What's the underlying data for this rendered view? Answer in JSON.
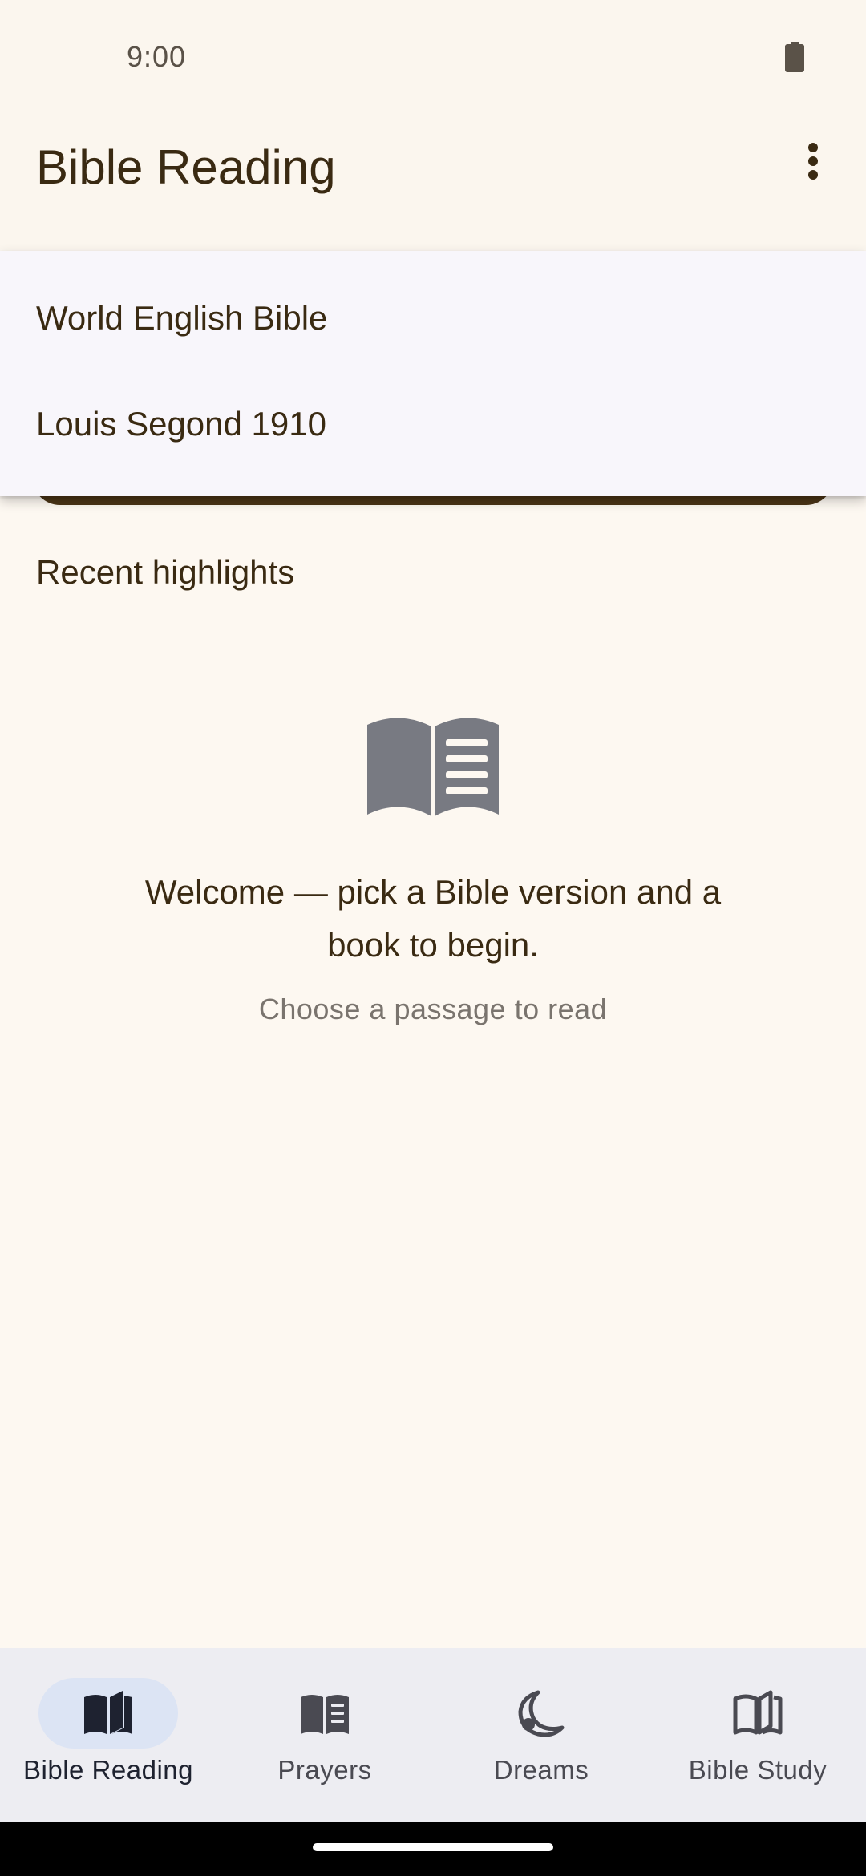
{
  "status_bar": {
    "time": "9:00"
  },
  "app_bar": {
    "title": "Bible Reading",
    "more_icon": "more-vertical-icon"
  },
  "version_menu": {
    "items": [
      {
        "label": "World English Bible"
      },
      {
        "label": "Louis Segond 1910"
      }
    ]
  },
  "main": {
    "recent_heading": "Recent highlights",
    "empty_state": {
      "icon": "book-open-icon",
      "message": "Welcome — pick a Bible version and a book to begin.",
      "subtitle": "Choose a passage to read"
    }
  },
  "bottom_nav": {
    "items": [
      {
        "label": "Bible Reading",
        "icon": "book-open-icon",
        "active": true
      },
      {
        "label": "Prayers",
        "icon": "book-icon",
        "active": false
      },
      {
        "label": "Dreams",
        "icon": "moon-icon",
        "active": false
      },
      {
        "label": "Bible Study",
        "icon": "book-outline-icon",
        "active": false
      }
    ]
  },
  "colors": {
    "background": "#FDF8F1",
    "app_bar": "#FBF6EE",
    "text_primary": "#3A2A12",
    "menu_background": "#F8F6FB",
    "nav_background": "#EDEDF2",
    "nav_active_pill": "#DCE4F4",
    "icon_gray": "#787A82"
  }
}
